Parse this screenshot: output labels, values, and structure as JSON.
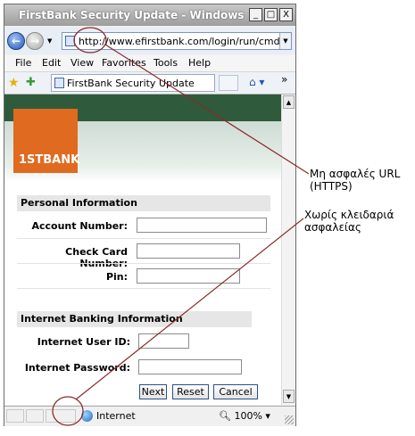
{
  "window": {
    "title": "FirstBank Security Update - Windows Inte...",
    "minimize": "_",
    "maximize": "□",
    "close": "X"
  },
  "address_bar": {
    "url": "http://www.efirstbank.com/login/run/cmd/z=",
    "back_icon": "back-arrow-icon",
    "forward_icon": "forward-arrow-icon"
  },
  "menu": {
    "items": [
      "File",
      "Edit",
      "View",
      "Favorites",
      "Tools",
      "Help"
    ]
  },
  "tabs": {
    "active_tab": "FirstBank Security Update"
  },
  "page": {
    "logo_text": "1STBANK",
    "personal_header": "Personal Information",
    "account_number_label": "Account Number:",
    "check_card_label": "Check Card Number:",
    "pin_label": "Pin:",
    "internet_banking_header": "Internet Banking Information",
    "user_id_label": "Internet User ID:",
    "password_label": "Internet Password:",
    "next_button": "Next",
    "reset_button": "Reset",
    "cancel_button": "Cancel"
  },
  "status_bar": {
    "zone": "Internet",
    "zoom": "100%"
  },
  "annotations": {
    "url_note_line1": "Μη ασφαλές URL",
    "url_note_line2": "(HTTPS)",
    "lock_note_line1": "Χωρίς κλειδαριά",
    "lock_note_line2": "ασφαλείας"
  },
  "colors": {
    "annotation_line": "#8b2a2a",
    "logo_orange": "#e06a20",
    "banner_green": "#2f5a3c"
  }
}
